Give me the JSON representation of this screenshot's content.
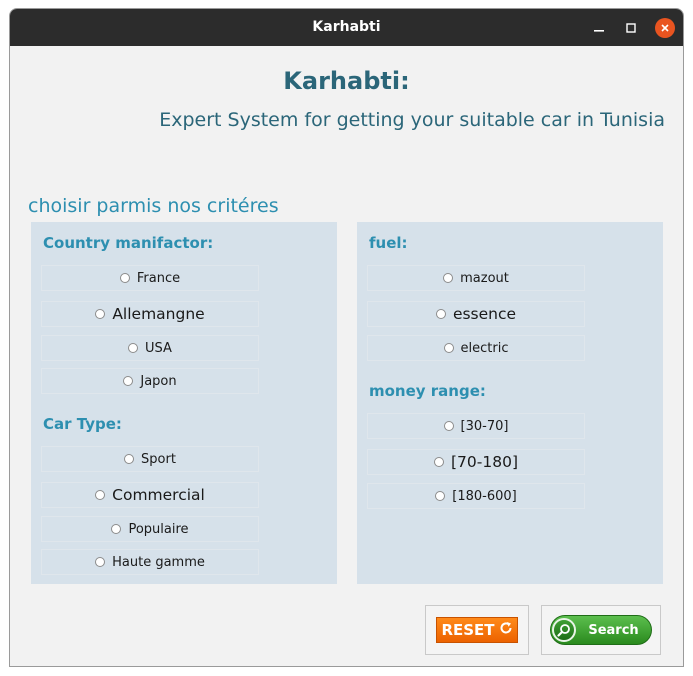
{
  "window": {
    "title": "Karhabti"
  },
  "header": {
    "title": "Karhabti:",
    "subtitle": "Expert System for getting your suitable car in Tunisia",
    "prompt": "choisir parmis nos critéres"
  },
  "left_panel": {
    "country": {
      "label": "Country manifactor:",
      "options": [
        "France",
        "Allemangne",
        "USA",
        "Japon"
      ]
    },
    "car_type": {
      "label": "Car Type:",
      "options": [
        "Sport",
        "Commercial",
        "Populaire",
        "Haute gamme"
      ]
    }
  },
  "right_panel": {
    "fuel": {
      "label": "fuel:",
      "options": [
        "mazout",
        "essence",
        "electric"
      ]
    },
    "money": {
      "label": "money range:",
      "options": [
        "[30-70]",
        "[70-180]",
        "[180-600]"
      ]
    }
  },
  "buttons": {
    "reset_label": "RESET",
    "search_label": "Search"
  },
  "icons": {
    "minimize": "minimize-icon",
    "maximize": "maximize-icon",
    "close": "close-icon",
    "reset": "refresh-icon",
    "search": "magnifier-icon"
  },
  "colors": {
    "accent": "#2d8fb0",
    "title": "#2b6679",
    "panel": "#d6e1ea",
    "reset": "#ec6200",
    "search": "#2a8a1e",
    "close": "#e95420"
  }
}
